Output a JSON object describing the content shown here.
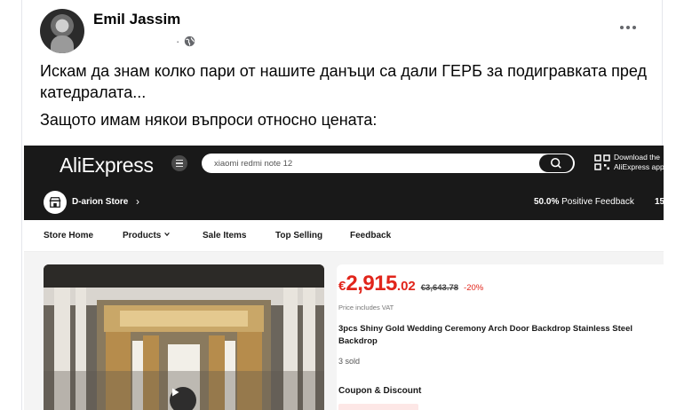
{
  "post": {
    "author": "Emil Jassim",
    "meta_time": "",
    "paragraphs": [
      "Искам да знам колко пари от нашите данъци са дали ГЕРБ за подигравката пред катедралата...",
      "Защото имам някои въпроси относно цената:"
    ],
    "more_label": "more-options"
  },
  "aliexpress": {
    "logo": "AliExpress",
    "search_value": "xiaomi redmi note 12",
    "download_line1": "Download the",
    "download_line2": "AliExpress app",
    "store_name": "D-arion Store",
    "store_arrow": "›",
    "feedback_percent": "50.0%",
    "feedback_label": " Positive Feedback",
    "feedback_extra": "15",
    "nav": [
      "Store Home",
      "Products",
      "Sale Items",
      "Top Selling",
      "Feedback"
    ],
    "price_currency": "€",
    "price_int": "2,915",
    "price_dec": ".02",
    "price_old": "€3,643.78",
    "price_discount": "-20%",
    "vat_note": "Price includes VAT",
    "product_title": "3pcs Shiny Gold Wedding Ceremony Arch Door Backdrop Stainless Steel Backdrop",
    "sold": "3 sold",
    "coupon_heading": "Coupon & Discount",
    "accent_color": "#e1251b"
  },
  "icons": [
    "globe-icon",
    "search-icon",
    "qr-code-icon",
    "store-icon",
    "chevron-down-icon",
    "play-icon",
    "menu-icon"
  ]
}
